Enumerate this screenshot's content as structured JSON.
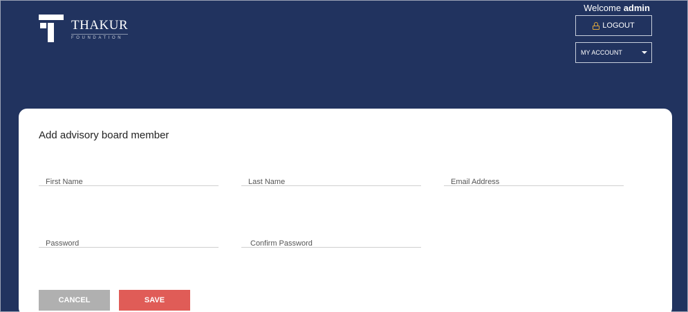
{
  "brand": {
    "title": "THAKUR",
    "subtitle": "FOUNDATION"
  },
  "header": {
    "welcome_prefix": "Welcome",
    "welcome_user": "admin",
    "logout_label": "LOGOUT",
    "account_label": "MY ACCOUNT"
  },
  "form": {
    "title": "Add advisory board member",
    "fields": {
      "first_name": "First Name",
      "last_name": "Last Name",
      "email": "Email Address",
      "password": "Password",
      "confirm_password": "Confirm Password"
    },
    "cancel_label": "CANCEL",
    "save_label": "SAVE"
  },
  "colors": {
    "header_bg": "#21335f",
    "save_button": "#e05c57",
    "cancel_button": "#b0b0b0",
    "lock_icon": "#e2a93b"
  }
}
